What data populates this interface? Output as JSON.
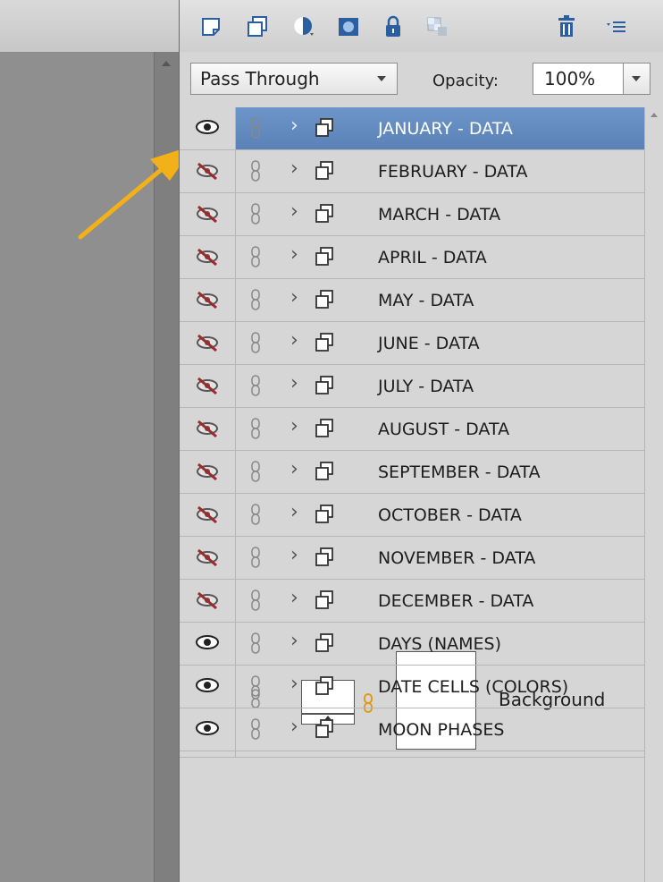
{
  "blend": {
    "mode": "Pass Through",
    "opacity_label": "Opacity:",
    "opacity_value": "100%"
  },
  "toolbar": {
    "icons": [
      "new-layer-icon",
      "new-group-icon",
      "adjustment-layer-icon",
      "layer-mask-icon",
      "lock-icon",
      "lock-transparency-icon",
      "trash-icon",
      "panel-menu-icon"
    ]
  },
  "layers": [
    {
      "name": "JANUARY - DATA",
      "visible": true,
      "selected": true
    },
    {
      "name": "FEBRUARY - DATA",
      "visible": false
    },
    {
      "name": "MARCH - DATA",
      "visible": false
    },
    {
      "name": "APRIL - DATA",
      "visible": false
    },
    {
      "name": "MAY - DATA",
      "visible": false
    },
    {
      "name": "JUNE - DATA",
      "visible": false
    },
    {
      "name": "JULY - DATA",
      "visible": false
    },
    {
      "name": "AUGUST - DATA",
      "visible": false
    },
    {
      "name": "SEPTEMBER - DATA",
      "visible": false
    },
    {
      "name": "OCTOBER - DATA",
      "visible": false
    },
    {
      "name": "NOVEMBER - DATA",
      "visible": false
    },
    {
      "name": "DECEMBER - DATA",
      "visible": false
    },
    {
      "name": "DAYS (NAMES)",
      "visible": true
    },
    {
      "name": "DATE CELLS (COLORS)",
      "visible": true
    },
    {
      "name": "MOON PHASES",
      "visible": true
    }
  ],
  "background_layer": {
    "name": "Background",
    "visible": true
  },
  "colors": {
    "selected": "#5f88bd",
    "arrow": "#f2b118",
    "hidden_eye": "#9b2a2a"
  }
}
